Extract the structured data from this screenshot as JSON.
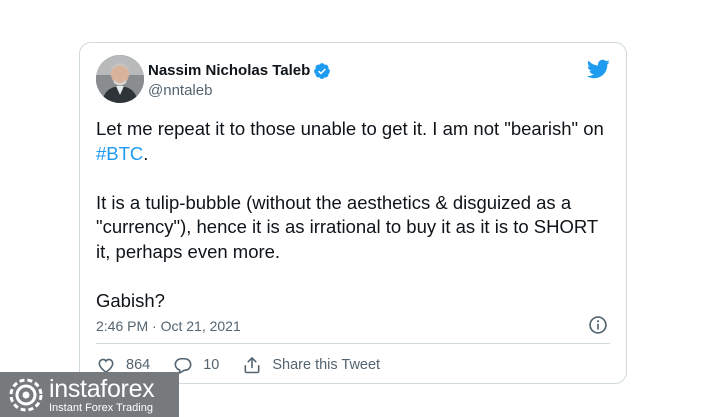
{
  "author": {
    "name": "Nassim Nicholas Taleb",
    "handle": "@nntaleb"
  },
  "tweet": {
    "p1_before": "Let me repeat it to those unable to get it. I am not \"bearish\" on ",
    "hashtag": "#BTC",
    "p1_after": ".",
    "p2": "It is a tulip-bubble (without the aesthetics & disguized as a \"currency\"), hence it is as irrational to buy it as it is to SHORT it, perhaps even more.",
    "p3": "Gabish?"
  },
  "timestamp": "2:46 PM · Oct 21, 2021",
  "actions": {
    "likes": "864",
    "replies": "10",
    "share_label": "Share this Tweet"
  },
  "watermark": {
    "brand": "instaforex",
    "tagline": "Instant Forex Trading"
  },
  "colors": {
    "twitter_blue": "#1d9bf0",
    "secondary_text": "#536471",
    "watermark_bg": "#777a7c"
  },
  "icons": [
    "verified-badge-icon",
    "twitter-bird-icon",
    "info-icon",
    "heart-icon",
    "reply-icon",
    "share-icon",
    "instaforex-logo-icon"
  ]
}
